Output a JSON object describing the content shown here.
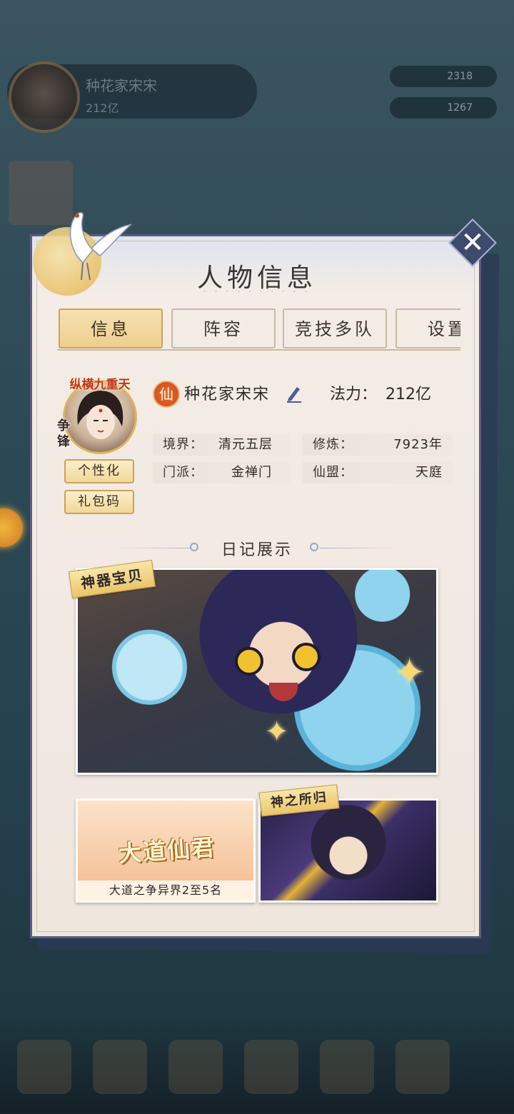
{
  "background": {
    "player_name": "种花家宋宋",
    "power": "212亿",
    "currency_1": "2318",
    "currency_2": "1267"
  },
  "panel": {
    "title": "人物信息",
    "subtitle": "· · · · · · · · · ·",
    "close_icon": "close-x-icon"
  },
  "tabs": [
    {
      "label": "信息",
      "active": true
    },
    {
      "label": "阵容",
      "active": false
    },
    {
      "label": "竞技多队",
      "active": false
    },
    {
      "label": "设置",
      "active": false
    }
  ],
  "profile": {
    "avatar_title": "纵横九重天",
    "avatar_side": "争锋",
    "personalize_label": "个性化",
    "giftcode_label": "礼包码",
    "badge_char": "仙",
    "name": "种花家宋宋",
    "power_label": "法力：",
    "power_value": "212亿",
    "stats": [
      {
        "key": "境界：",
        "value": "清元五层"
      },
      {
        "key": "修炼：",
        "value": "7923年"
      },
      {
        "key": "门派：",
        "value": "金禅门"
      },
      {
        "key": "仙盟：",
        "value": "天庭"
      }
    ]
  },
  "diary": {
    "title": "日记展示",
    "cards": [
      {
        "ribbon": "神器宝贝"
      },
      {
        "logo": "大道仙君",
        "caption": "大道之争异界2至5名"
      },
      {
        "ribbon": "神之所归"
      }
    ]
  },
  "colors": {
    "panel_bg": "#f1e9e2",
    "panel_border": "#5a5c82",
    "tab_active": "#efcf8d",
    "accent_gold": "#c9a35b",
    "badge_orange": "#c84a18"
  }
}
